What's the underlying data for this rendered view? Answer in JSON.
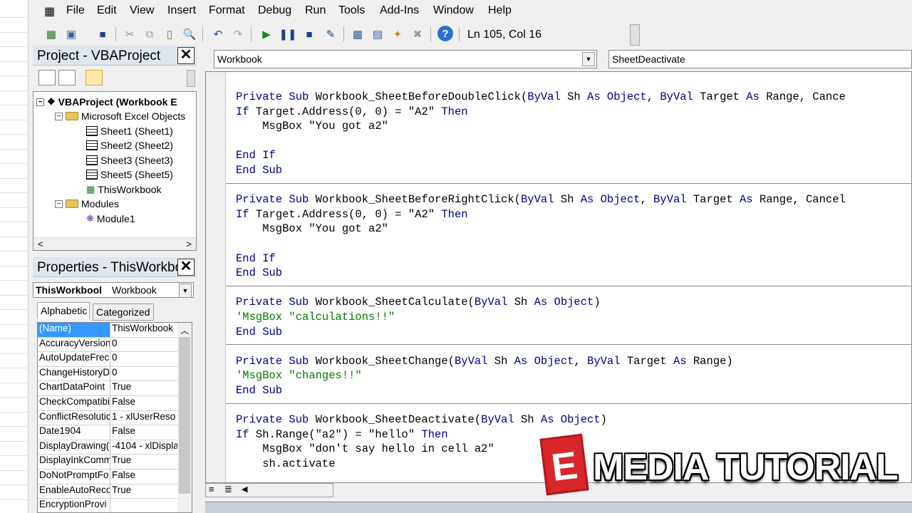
{
  "menu": [
    "File",
    "Edit",
    "View",
    "Insert",
    "Format",
    "Debug",
    "Run",
    "Tools",
    "Add-Ins",
    "Window",
    "Help"
  ],
  "toolbar": {
    "position": "Ln 105, Col 16"
  },
  "project": {
    "title": "Project - VBAProject",
    "tree": [
      {
        "label": "VBAProject (Workbook E",
        "bold": true
      },
      {
        "label": "Microsoft Excel Objects"
      },
      {
        "label": "Sheet1 (Sheet1)"
      },
      {
        "label": "Sheet2 (Sheet2)"
      },
      {
        "label": "Sheet3 (Sheet3)"
      },
      {
        "label": "Sheet5 (Sheet5)"
      },
      {
        "label": "ThisWorkbook"
      },
      {
        "label": "Modules"
      },
      {
        "label": "Module1"
      }
    ]
  },
  "properties": {
    "title": "Properties - ThisWorkbo",
    "object_name": "ThisWorkbool",
    "object_type": "Workbook",
    "tabs": [
      "Alphabetic",
      "Categorized"
    ],
    "rows": [
      [
        "(Name)",
        "ThisWorkbook"
      ],
      [
        "AccuracyVersion",
        "0"
      ],
      [
        "AutoUpdateFrec",
        "0"
      ],
      [
        "ChangeHistoryD",
        "0"
      ],
      [
        "ChartDataPoint",
        "True"
      ],
      [
        "CheckCompatibi",
        "False"
      ],
      [
        "ConflictResolutic",
        "1 - xlUserReso"
      ],
      [
        "Date1904",
        "False"
      ],
      [
        "DisplayDrawing(",
        "-4104 - xlDispla"
      ],
      [
        "DisplayInkComm",
        "True"
      ],
      [
        "DoNotPromptFo",
        "False"
      ],
      [
        "EnableAutoReco",
        "True"
      ],
      [
        "EncryptionProvi",
        ""
      ]
    ]
  },
  "code": {
    "object_combo": "Workbook",
    "proc_combo": "SheetDeactivate",
    "lines": [
      [
        [
          "kw",
          "Private Sub "
        ],
        [
          "",
          "Workbook_SheetBeforeDoubleClick("
        ],
        [
          "kw",
          "ByVal"
        ],
        [
          "",
          " Sh "
        ],
        [
          "kw",
          "As Object"
        ],
        [
          "",
          ", "
        ],
        [
          "kw",
          "ByVal"
        ],
        [
          "",
          " Target "
        ],
        [
          "kw",
          "As"
        ],
        [
          "",
          " Range, Cance"
        ]
      ],
      [
        [
          "kw",
          "If"
        ],
        [
          "",
          " Target.Address(0, 0) = \"A2\" "
        ],
        [
          "kw",
          "Then"
        ]
      ],
      [
        [
          "",
          "    MsgBox \"You got a2\""
        ]
      ],
      [],
      [
        [
          "kw",
          "End If"
        ]
      ],
      [
        [
          "kw",
          "End Sub"
        ]
      ],
      [],
      [
        [
          "kw",
          "Private Sub "
        ],
        [
          "",
          "Workbook_SheetBeforeRightClick("
        ],
        [
          "kw",
          "ByVal"
        ],
        [
          "",
          " Sh "
        ],
        [
          "kw",
          "As Object"
        ],
        [
          "",
          ", "
        ],
        [
          "kw",
          "ByVal"
        ],
        [
          "",
          " Target "
        ],
        [
          "kw",
          "As"
        ],
        [
          "",
          " Range, Cancel"
        ]
      ],
      [
        [
          "kw",
          "If"
        ],
        [
          "",
          " Target.Address(0, 0) = \"A2\" "
        ],
        [
          "kw",
          "Then"
        ]
      ],
      [
        [
          "",
          "    MsgBox \"You got a2\""
        ]
      ],
      [],
      [
        [
          "kw",
          "End If"
        ]
      ],
      [
        [
          "kw",
          "End Sub"
        ]
      ],
      [],
      [
        [
          "kw",
          "Private Sub "
        ],
        [
          "",
          "Workbook_SheetCalculate("
        ],
        [
          "kw",
          "ByVal"
        ],
        [
          "",
          " Sh "
        ],
        [
          "kw",
          "As Object"
        ],
        [
          "",
          ")"
        ]
      ],
      [
        [
          "cm",
          "'MsgBox \"calculations!!\""
        ]
      ],
      [
        [
          "kw",
          "End Sub"
        ]
      ],
      [],
      [
        [
          "kw",
          "Private Sub "
        ],
        [
          "",
          "Workbook_SheetChange("
        ],
        [
          "kw",
          "ByVal"
        ],
        [
          "",
          " Sh "
        ],
        [
          "kw",
          "As Object"
        ],
        [
          "",
          ", "
        ],
        [
          "kw",
          "ByVal"
        ],
        [
          "",
          " Target "
        ],
        [
          "kw",
          "As"
        ],
        [
          "",
          " Range)"
        ]
      ],
      [
        [
          "cm",
          "'MsgBox \"changes!!\""
        ]
      ],
      [
        [
          "kw",
          "End Sub"
        ]
      ],
      [],
      [
        [
          "kw",
          "Private Sub "
        ],
        [
          "",
          "Workbook_SheetDeactivate("
        ],
        [
          "kw",
          "ByVal"
        ],
        [
          "",
          " Sh "
        ],
        [
          "kw",
          "As Object"
        ],
        [
          "",
          ")"
        ]
      ],
      [
        [
          "kw",
          "If"
        ],
        [
          "",
          " Sh.Range(\"a2\") = \"hello\" "
        ],
        [
          "kw",
          "Then"
        ]
      ],
      [
        [
          "",
          "    MsgBox \"don't say hello in cell a2\""
        ]
      ],
      [
        [
          "",
          "    sh.activate"
        ]
      ]
    ]
  },
  "watermark": {
    "letter": "E",
    "text": "MEDIA TUTORIAL"
  },
  "colors": {
    "keyword": "#00008b",
    "comment": "#007a00",
    "watermark_red": "#d8262b"
  }
}
